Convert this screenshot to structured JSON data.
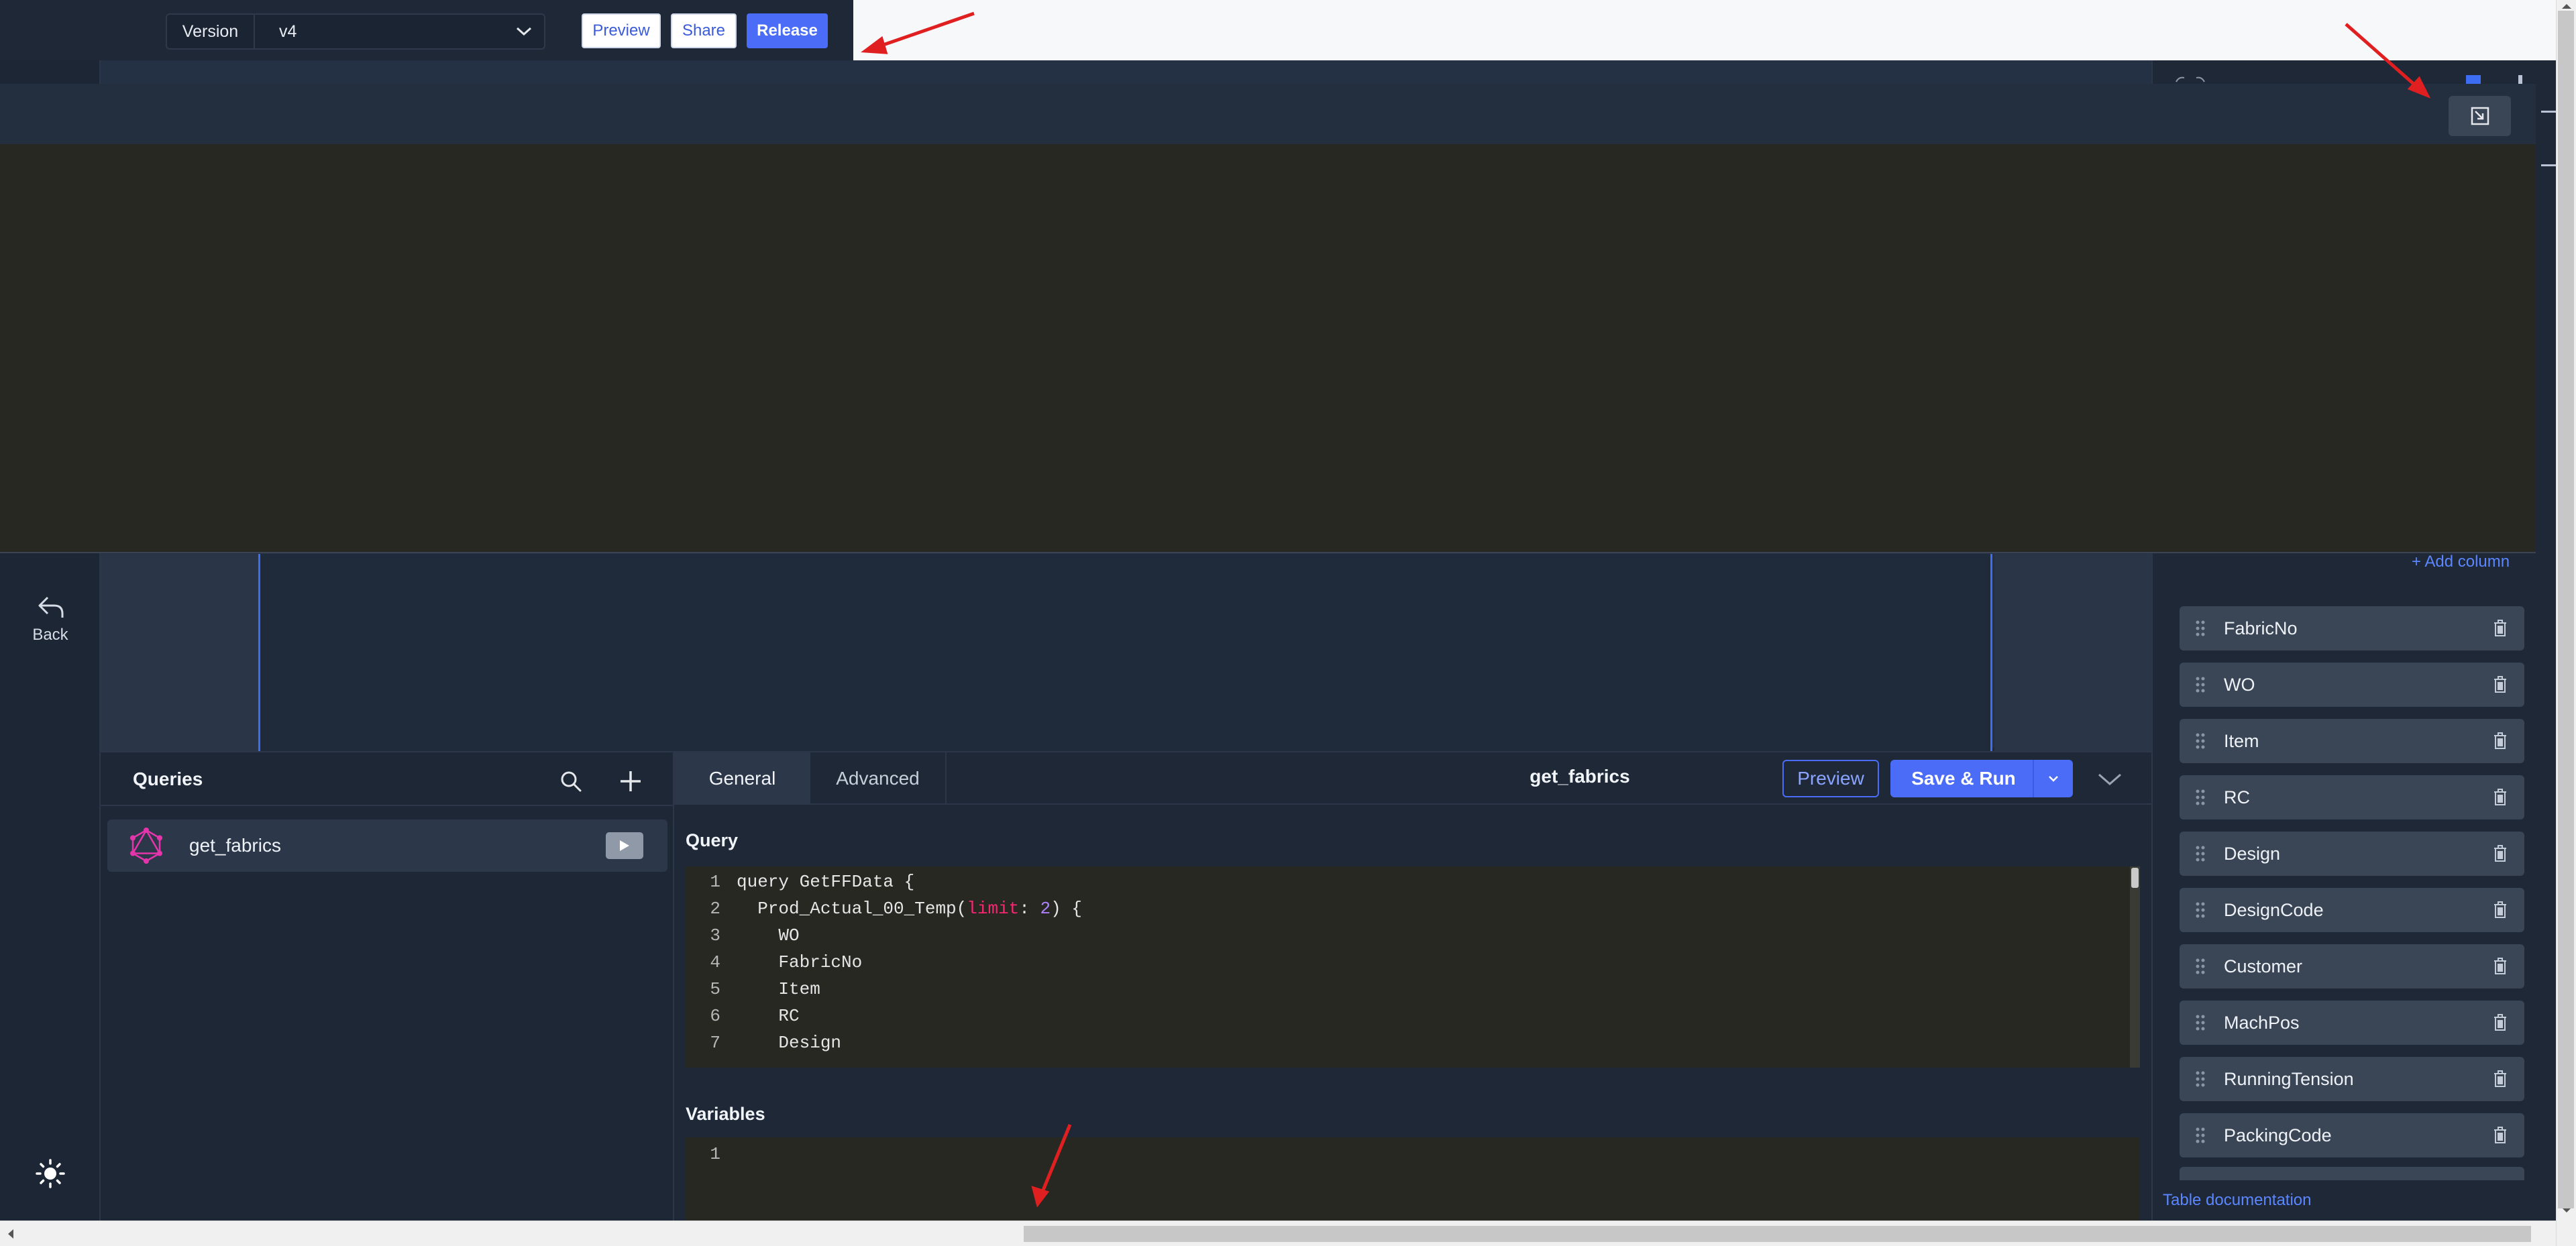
{
  "toolbar": {
    "version_label": "Version",
    "version_value": "v4",
    "preview_label": "Preview",
    "share_label": "Share",
    "release_label": "Release"
  },
  "sidebar": {
    "back_label": "Back",
    "theme_icon": "sun-icon"
  },
  "overlay": {
    "collapse_icon": "collapse-icon"
  },
  "queries": {
    "title": "Queries",
    "items": [
      {
        "name": "get_fabrics",
        "icon": "graphql-icon"
      }
    ]
  },
  "editor": {
    "tabs": [
      "General",
      "Advanced"
    ],
    "active_tab": "General",
    "query_name": "get_fabrics",
    "preview_label": "Preview",
    "save_run_label": "Save & Run",
    "query_section_label": "Query",
    "variables_section_label": "Variables",
    "code_lines": [
      {
        "n": "1",
        "text": "query GetFFData {"
      },
      {
        "n": "2",
        "text": "  Prod_Actual_00_Temp(limit: 2) {"
      },
      {
        "n": "3",
        "text": "    WO"
      },
      {
        "n": "4",
        "text": "    FabricNo"
      },
      {
        "n": "5",
        "text": "    Item"
      },
      {
        "n": "6",
        "text": "    RC"
      },
      {
        "n": "7",
        "text": "    Design"
      }
    ],
    "variables_lines": [
      {
        "n": "1",
        "text": ""
      }
    ]
  },
  "columns": {
    "add_label": "+ Add column",
    "items": [
      "FabricNo",
      "WO",
      "Item",
      "RC",
      "Design",
      "DesignCode",
      "Customer",
      "MachPos",
      "RunningTension",
      "PackingCode"
    ],
    "doc_link": "Table documentation"
  },
  "colors": {
    "accent": "#4a6cf7",
    "link": "#5b86ff",
    "annotation": "#e02020",
    "graphql": "#e535ab"
  }
}
